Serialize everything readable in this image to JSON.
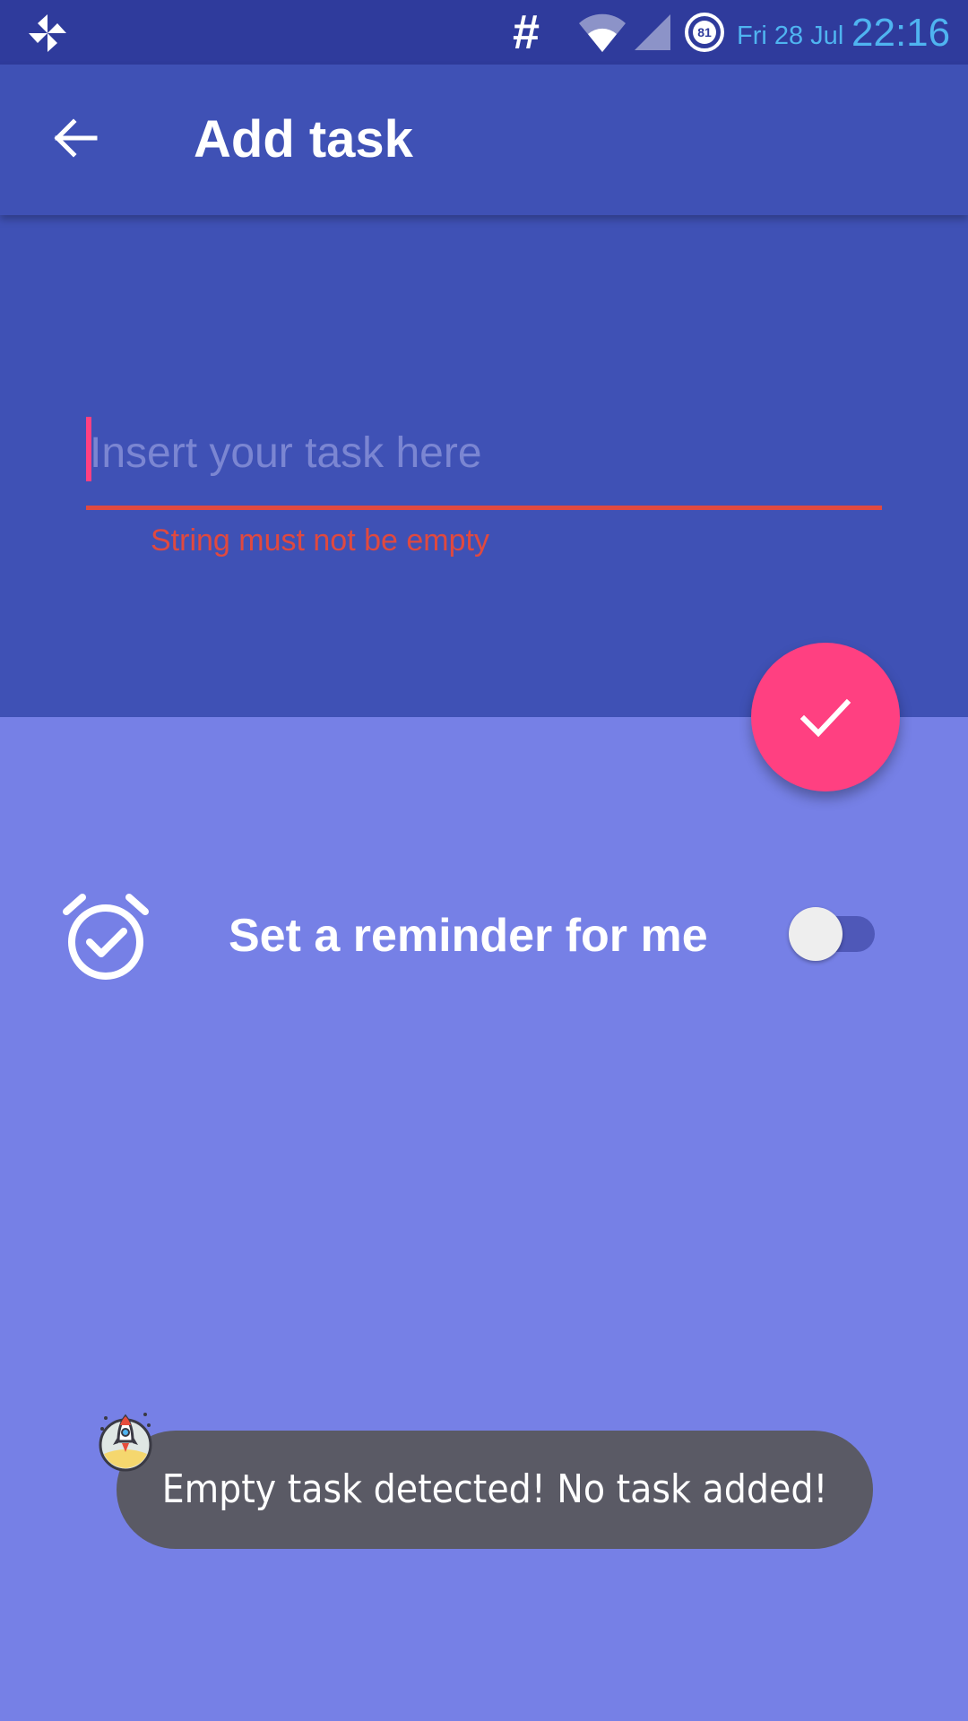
{
  "status_bar": {
    "hash_symbol": "#",
    "battery_level": "81",
    "date": "Fri 28 Jul",
    "time": "22:16",
    "icons": [
      "pinwheel-icon",
      "wifi-icon",
      "signal-icon",
      "battery-icon"
    ]
  },
  "app_bar": {
    "title": "Add task",
    "back_icon": "arrow-left-icon"
  },
  "task_form": {
    "placeholder": "Insert your task here",
    "value": "",
    "error": "String must not be empty"
  },
  "fab": {
    "icon": "check-icon"
  },
  "reminder": {
    "label": "Set a reminder for me",
    "icon": "alarm-check-icon",
    "enabled": false
  },
  "toast": {
    "message": "Empty task detected! No task added!",
    "badge_icon": "rocket-icon"
  },
  "colors": {
    "status_bar": "#2f3b9c",
    "primary": "#3f51b5",
    "background": "#7680e6",
    "accent": "#ff4081",
    "error": "#e0493f",
    "toast": "#5a5a65",
    "clock": "#4fb4f0"
  }
}
